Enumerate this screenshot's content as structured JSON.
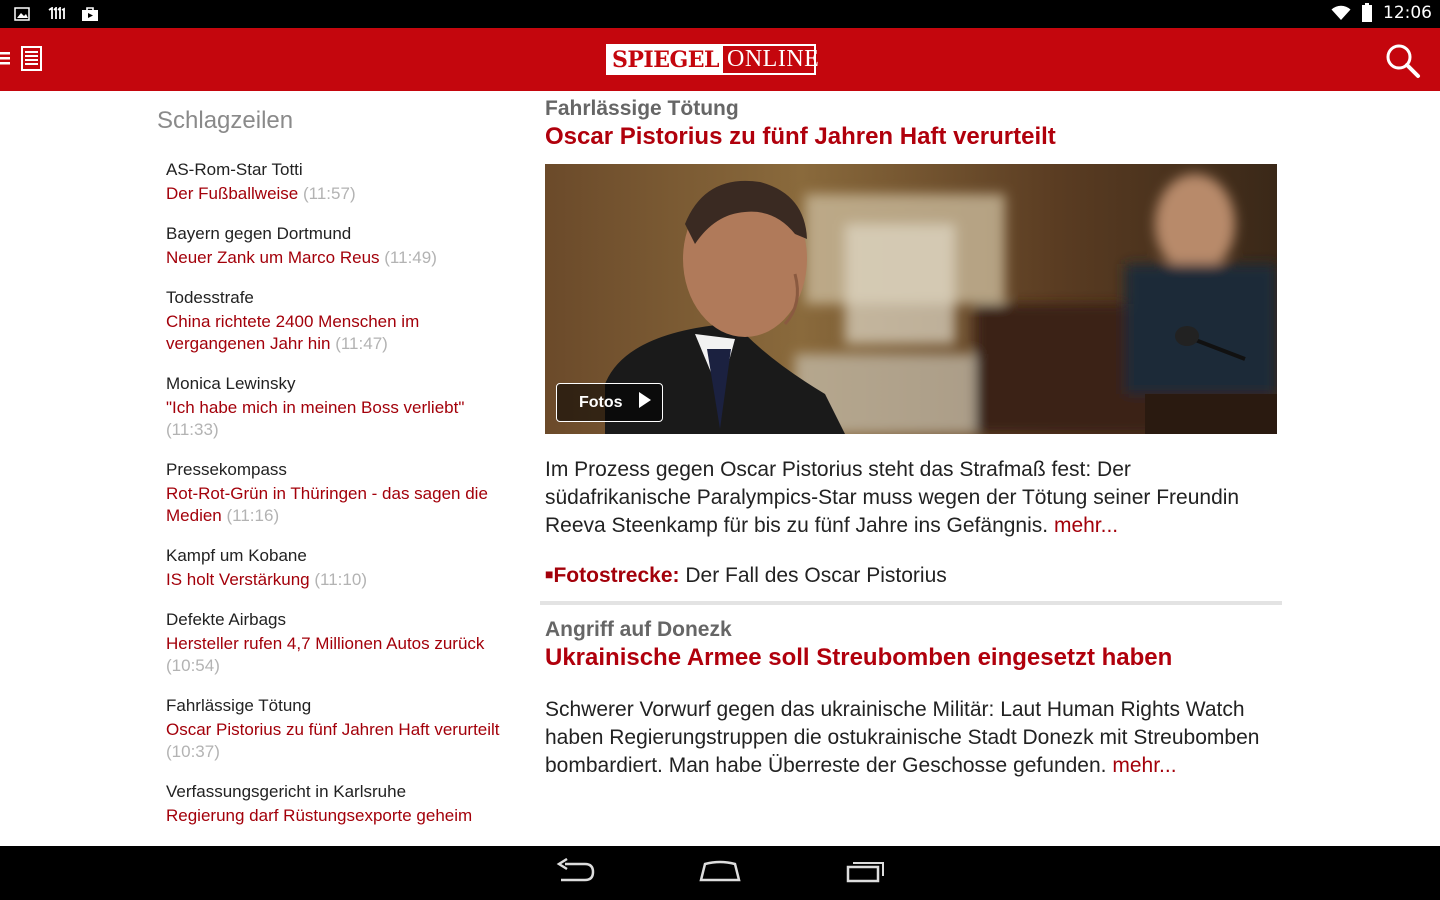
{
  "status_bar": {
    "clock": "12:06",
    "left_icons": [
      "gallery-icon",
      "news-app-icon",
      "store-bag-icon"
    ],
    "right_icons": [
      "wifi-icon",
      "battery-icon"
    ]
  },
  "app_bar": {
    "logo_part1": "SPIEGEL",
    "logo_part2": "ONLINE",
    "background_color": "#c4060d",
    "menu_icon": "menu-list-icon",
    "search_icon": "search-icon"
  },
  "sidebar": {
    "title": "Schlagzeilen",
    "items": [
      {
        "kicker": "AS-Rom-Star Totti",
        "headline": "Der Fußballweise",
        "time": "(11:57)"
      },
      {
        "kicker": "Bayern gegen Dortmund",
        "headline": "Neuer Zank um Marco Reus",
        "time": "(11:49)"
      },
      {
        "kicker": "Todesstrafe",
        "headline": "China richtete 2400 Menschen im vergangenen Jahr hin",
        "time": "(11:47)"
      },
      {
        "kicker": "Monica Lewinsky",
        "headline": "\"Ich habe mich in meinen Boss verliebt\"",
        "time": "(11:33)"
      },
      {
        "kicker": "Pressekompass",
        "headline": "Rot-Rot-Grün in Thüringen - das sagen die Medien",
        "time": "(11:16)"
      },
      {
        "kicker": "Kampf um Kobane",
        "headline": "IS holt Verstärkung",
        "time": "(11:10)"
      },
      {
        "kicker": "Defekte Airbags",
        "headline": "Hersteller rufen 4,7 Millionen Autos zurück",
        "time": "(10:54)"
      },
      {
        "kicker": "Fahrlässige Tötung",
        "headline": "Oscar Pistorius zu fünf Jahren Haft verurteilt",
        "time": "(10:37)"
      },
      {
        "kicker": "Verfassungsgericht in Karlsruhe",
        "headline": "Regierung darf Rüstungsexporte geheim",
        "time": ""
      }
    ]
  },
  "main": {
    "article1": {
      "kicker": "Fahrlässige Tötung",
      "title": "Oscar Pistorius zu fünf Jahren Haft verurteilt",
      "photo_button": "Fotos",
      "body": "Im Prozess gegen Oscar Pistorius steht das Strafmaß fest: Der südafrikanische Paralympics-Star muss wegen der Tötung seiner Freundin Reeva Steenkamp für bis zu fünf Jahre ins Gefängnis.",
      "more": "mehr...",
      "gallery_label": "Fotostrecke:",
      "gallery_text": "Der Fall des Oscar Pistorius"
    },
    "article2": {
      "kicker": "Angriff auf Donezk",
      "title": "Ukrainische Armee soll Streubomben eingesetzt haben",
      "body": "Schwerer Vorwurf gegen das ukrainische Militär: Laut Human Rights Watch haben Regierungstruppen die ostukrainische Stadt Donezk mit Streubomben bombardiert. Man habe Überreste der Geschosse gefunden.",
      "more": "mehr..."
    }
  },
  "nav_bar": {
    "buttons": [
      "back-icon",
      "home-icon",
      "recent-apps-icon"
    ]
  }
}
